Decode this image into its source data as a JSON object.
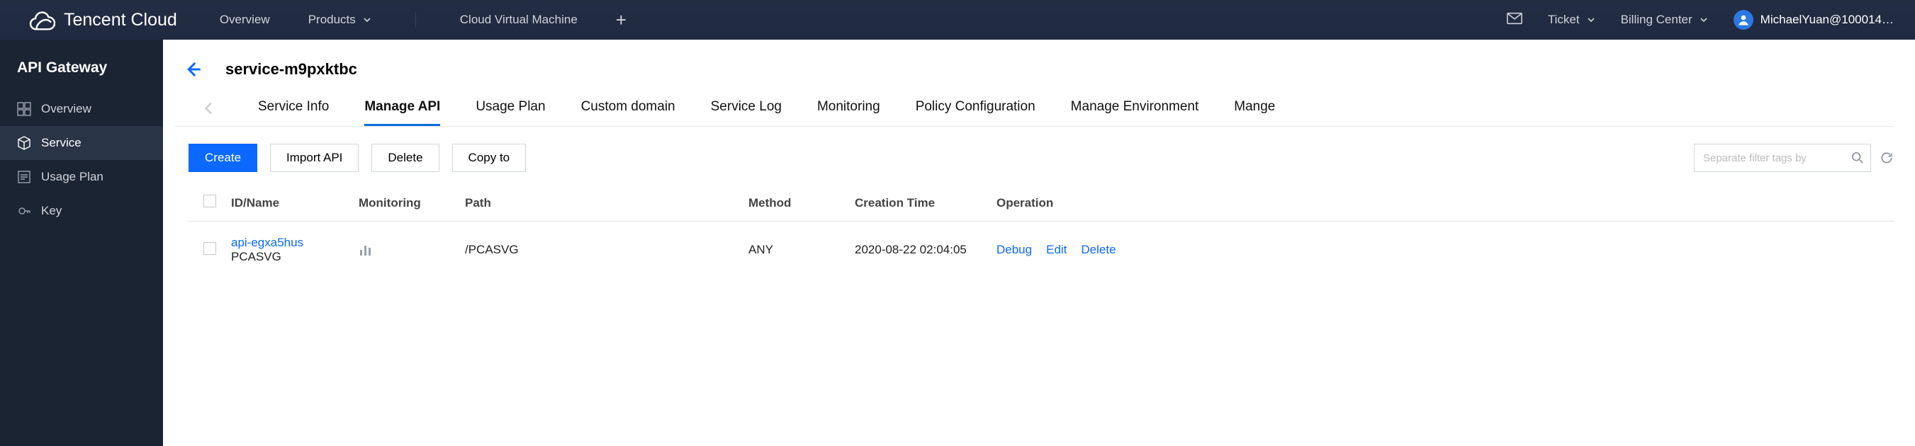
{
  "brand": "Tencent Cloud",
  "topnav": {
    "overview": "Overview",
    "products": "Products",
    "cvm": "Cloud Virtual Machine",
    "ticket": "Ticket",
    "billing": "Billing Center",
    "user": "MichaelYuan@100014…"
  },
  "sidebar": {
    "title": "API Gateway",
    "items": [
      {
        "label": "Overview"
      },
      {
        "label": "Service"
      },
      {
        "label": "Usage Plan"
      },
      {
        "label": "Key"
      }
    ]
  },
  "page": {
    "title": "service-m9pxktbc"
  },
  "tabs": [
    "Service Info",
    "Manage API",
    "Usage Plan",
    "Custom domain",
    "Service Log",
    "Monitoring",
    "Policy Configuration",
    "Manage Environment",
    "Mange"
  ],
  "toolbar": {
    "create_label": "Create",
    "import_label": "Import API",
    "delete_label": "Delete",
    "copy_label": "Copy to",
    "search_placeholder": "Separate filter tags by"
  },
  "table": {
    "headers": {
      "id": "ID/Name",
      "monitoring": "Monitoring",
      "path": "Path",
      "method": "Method",
      "ctime": "Creation Time",
      "op": "Operation"
    },
    "rows": [
      {
        "id": "api-egxa5hus",
        "name": "PCASVG",
        "path": "/PCASVG",
        "method": "ANY",
        "ctime": "2020-08-22 02:04:05",
        "op_debug": "Debug",
        "op_edit": "Edit",
        "op_delete": "Delete"
      }
    ]
  }
}
